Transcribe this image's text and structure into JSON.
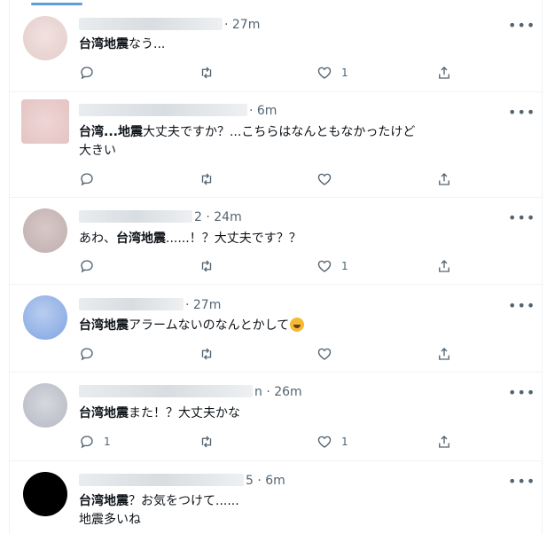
{
  "tweets": [
    {
      "time": "· 27m",
      "text_bold": "台湾地震",
      "text_rest": "なう...",
      "text_line2": "",
      "reply_count": "",
      "retweet_count": "",
      "like_count": "1",
      "avatar_color": "#e8d5d3"
    },
    {
      "time": "· 6m",
      "text_bold": "台湾...地震",
      "text_rest": "大丈夫ですか？...こちらはなんともなかったけど",
      "text_line2": "大きい",
      "reply_count": "",
      "retweet_count": "",
      "like_count": "",
      "avatar_color": "#e9c9c9"
    },
    {
      "time": "2 · 24m",
      "text_pre": "あわ、",
      "text_bold": "台湾地震",
      "text_rest": "......！？大丈夫です？？",
      "text_line2": "",
      "reply_count": "",
      "retweet_count": "",
      "like_count": "1",
      "avatar_color": "#c9b8b8"
    },
    {
      "time": "· 27m",
      "text_bold": "台湾地震",
      "text_rest": "アラームないのなんとかして",
      "emoji": "crying-face-emoji",
      "text_line2": "",
      "reply_count": "",
      "retweet_count": "",
      "like_count": "",
      "avatar_color": "#8fb0e6"
    },
    {
      "time": "n · 26m",
      "text_bold": "台湾地震",
      "text_rest": "また！？大丈夫かな",
      "text_line2": "",
      "reply_count": "1",
      "retweet_count": "",
      "like_count": "1",
      "avatar_color": "#c3c6cf"
    },
    {
      "time": "5 · 6m",
      "text_bold": "台湾地震",
      "text_rest": "？お気をつけて......",
      "text_line2": "地震多いね",
      "reply_count": "",
      "retweet_count": "",
      "like_count": "",
      "avatar_color": "#000000"
    }
  ],
  "colors": {
    "secondary_text": "#536471",
    "divider": "#eff3f4",
    "tab_indicator": "#5a9fdc"
  }
}
